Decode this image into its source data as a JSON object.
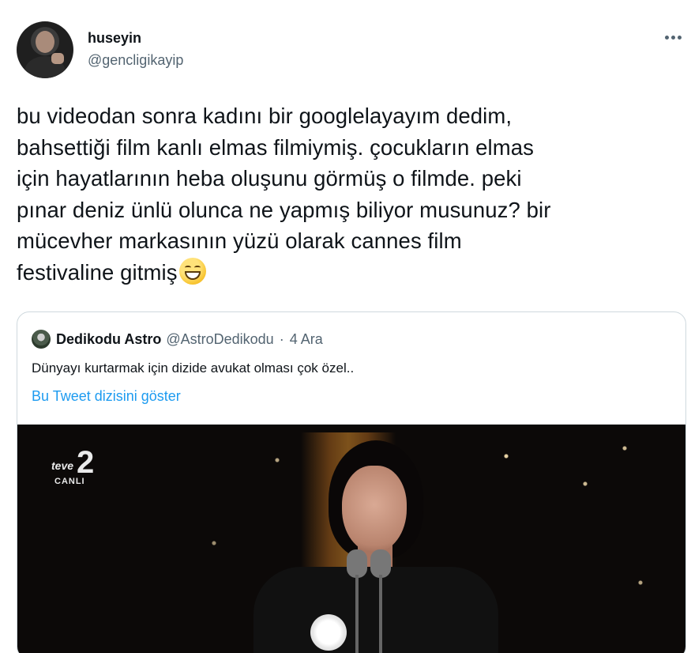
{
  "author": {
    "name": "huseyin",
    "handle": "@gencligikayip",
    "avatar_icon": "profile-avatar"
  },
  "tweet": {
    "line1": "bu videodan sonra kadını bir googlelayayım dedim,",
    "line2": "bahsettiği film kanlı elmas filmiymiş. çocukların elmas",
    "line3": "için hayatlarının heba oluşunu görmüş o filmde. peki",
    "line4": "pınar deniz ünlü olunca ne yapmış biliyor musunuz? bir",
    "line5": "mücevher markasının yüzü olarak cannes film",
    "line6": "festivaline gitmiş",
    "emoji": "grinning-face-smiling-eyes-emoji"
  },
  "quoted": {
    "name": "Dedikodu Astro",
    "handle": "@AstroDedikodu",
    "separator": "·",
    "date": "4 Ara",
    "text": "Dünyayı kurtarmak için dizide avukat olması çok özel..",
    "thread_link": "Bu Tweet dizisini göster",
    "media": {
      "channel_logo": "teve",
      "channel_number": "2",
      "channel_status": "CANLI"
    }
  },
  "colors": {
    "text": "#0f1419",
    "secondary": "#536471",
    "link": "#1d9bf0",
    "border": "#cfd9de"
  }
}
